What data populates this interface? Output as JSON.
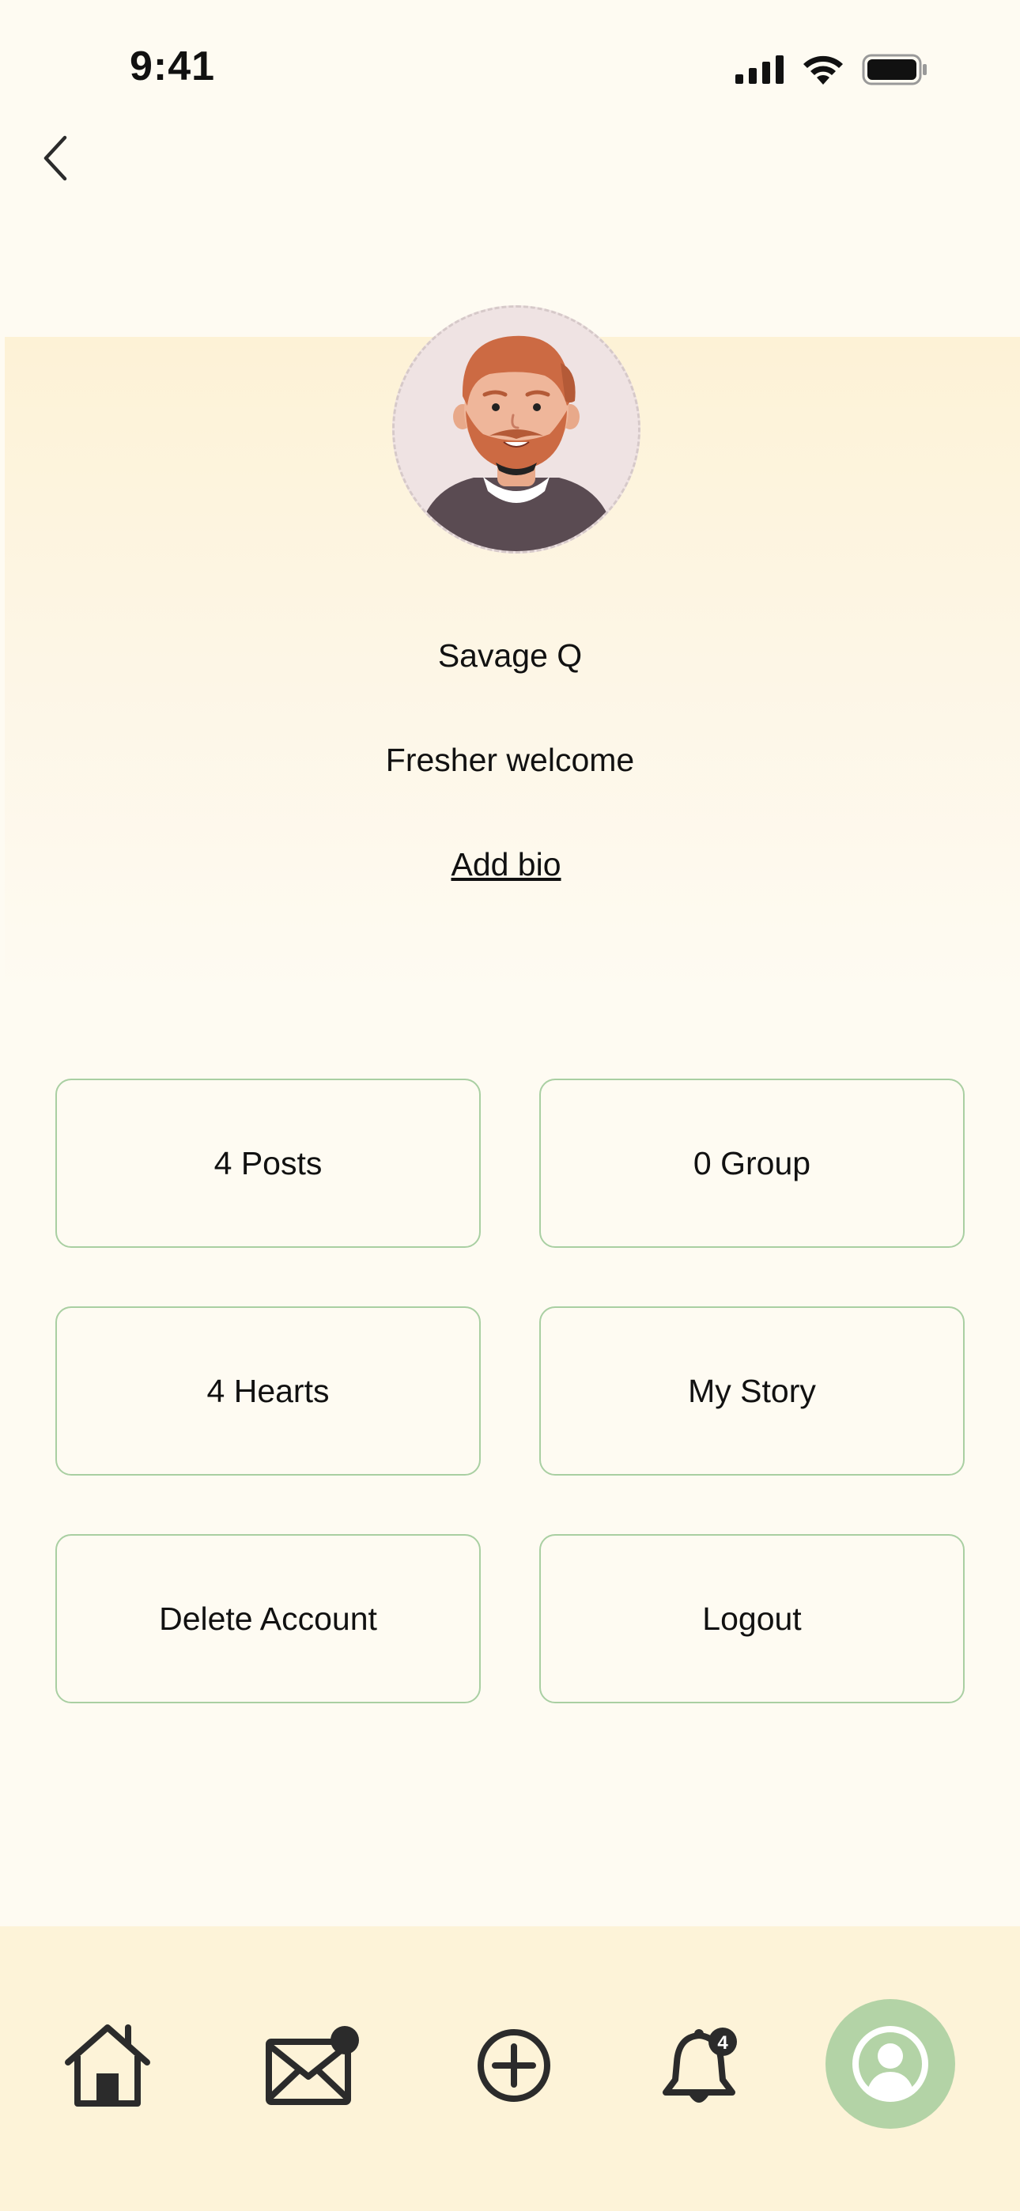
{
  "status_bar": {
    "time": "9:41"
  },
  "header": {
    "back_icon": "chevron-left-icon"
  },
  "profile": {
    "name": "Savage Q",
    "status": "Fresher welcome",
    "add_bio_label": "Add bio",
    "avatar_icon": "bearded-man-avatar"
  },
  "actions": [
    {
      "label": "4 Posts"
    },
    {
      "label": "0 Group"
    },
    {
      "label": "4 Hearts"
    },
    {
      "label": "My Story"
    },
    {
      "label": "Delete Account"
    },
    {
      "label": "Logout"
    }
  ],
  "bottom_nav": {
    "items": [
      {
        "icon": "home-icon"
      },
      {
        "icon": "mail-icon",
        "has_dot": true
      },
      {
        "icon": "plus-circle-icon"
      },
      {
        "icon": "bell-icon",
        "badge": "4"
      },
      {
        "icon": "profile-icon",
        "active": true
      }
    ]
  },
  "colors": {
    "background": "#fefbf2",
    "header_band": "#fdf3d8",
    "button_border": "#a9cfa2",
    "active_nav": "#b3d3a6",
    "icon_dark": "#2b2b2b"
  }
}
